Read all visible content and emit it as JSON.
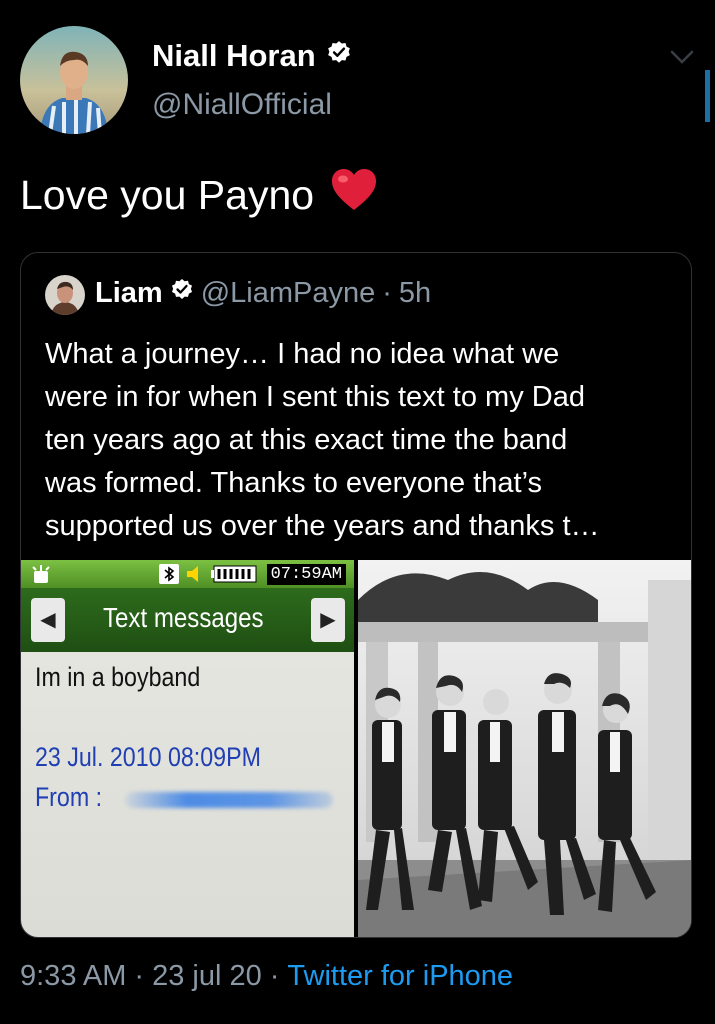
{
  "author": {
    "display_name": "Niall Horan",
    "handle": "@NiallOfficial",
    "verified": true
  },
  "tweet": {
    "text": "Love you Payno",
    "emoji": "heart"
  },
  "quoted_tweet": {
    "display_name": "Liam",
    "handle": "@LiamPayne",
    "separator": "·",
    "age": "5h",
    "verified": true,
    "lines": [
      "What a journey… I had no idea what we",
      "were in for when I sent this text to my Dad",
      "ten years ago at this exact time the band",
      "was formed. Thanks to everyone that’s",
      "supported us over the years and thanks t…"
    ],
    "phone_screen": {
      "clock": "07:59AM",
      "title": "Text messages",
      "message": "Im in a boyband",
      "date": "23 Jul. 2010 08:09PM",
      "from_label": "From :"
    }
  },
  "footer": {
    "time": "9:33 AM",
    "sep1": "·",
    "date": "23 jul 20",
    "sep2": "·",
    "source": "Twitter for iPhone"
  },
  "colors": {
    "background": "#000000",
    "secondary_text": "#8b98a5",
    "link": "#1d9bf0",
    "card_border": "#2f3336",
    "heart": "#e0245e"
  },
  "icons": [
    "verified-badge-icon",
    "chevron-down-icon",
    "heart-emoji-icon",
    "bluetooth-icon",
    "volume-icon",
    "battery-icon",
    "alarm-icon"
  ]
}
